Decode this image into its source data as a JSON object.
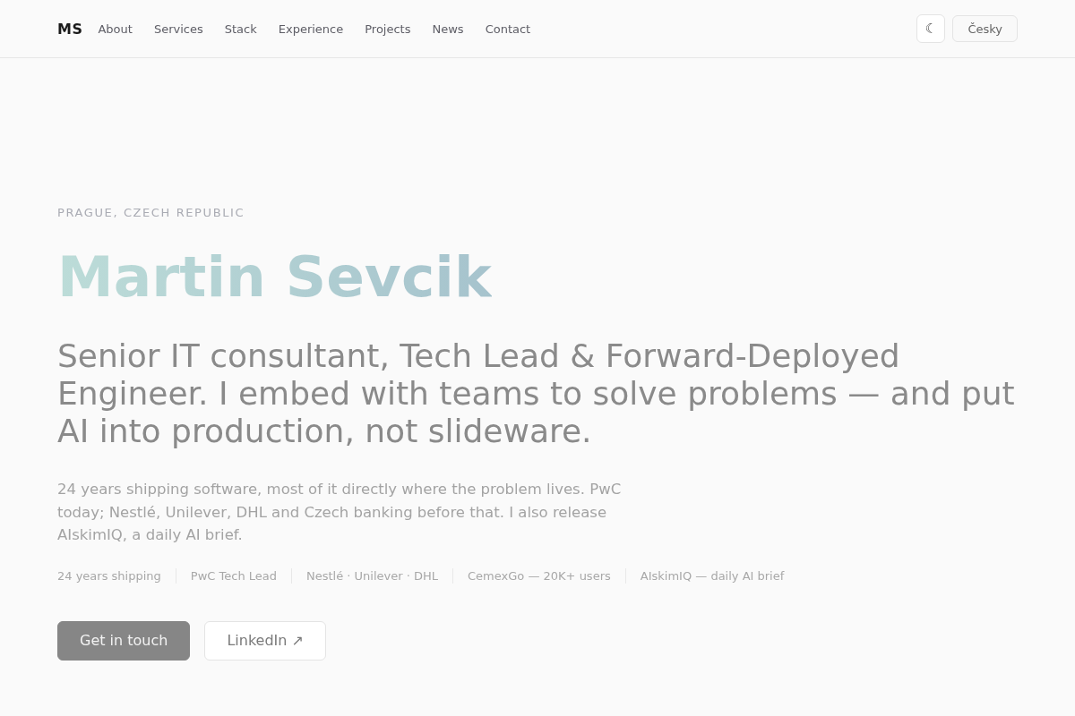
{
  "nav": {
    "logo": "MS",
    "links": [
      "About",
      "Services",
      "Stack",
      "Experience",
      "Projects",
      "News",
      "Contact"
    ]
  },
  "controls": {
    "theme_toggle": "☾",
    "language": "Česky"
  },
  "hero": {
    "location": "PRAGUE, CZECH REPUBLIC",
    "name": "Martin Sevcik",
    "tagline": "Senior IT consultant, Tech Lead & Forward-Deployed Engineer. I embed with teams to solve problems — and put AI into production, not slideware.",
    "intro": "24 years shipping software, most of it directly where the problem lives. PwC today; Nestlé, Unilever, DHL and Czech banking before that. I also release AIskimIQ, a daily AI brief.",
    "facts": [
      "24 years shipping",
      "PwC Tech Lead",
      "Nestlé · Unilever · DHL",
      "CemexGo — 20K+ users",
      "AIskimIQ — daily AI brief"
    ],
    "actions": [
      {
        "label": "Get in touch",
        "kind": "primary"
      },
      {
        "label": "LinkedIn ↗",
        "kind": "secondary"
      }
    ]
  }
}
